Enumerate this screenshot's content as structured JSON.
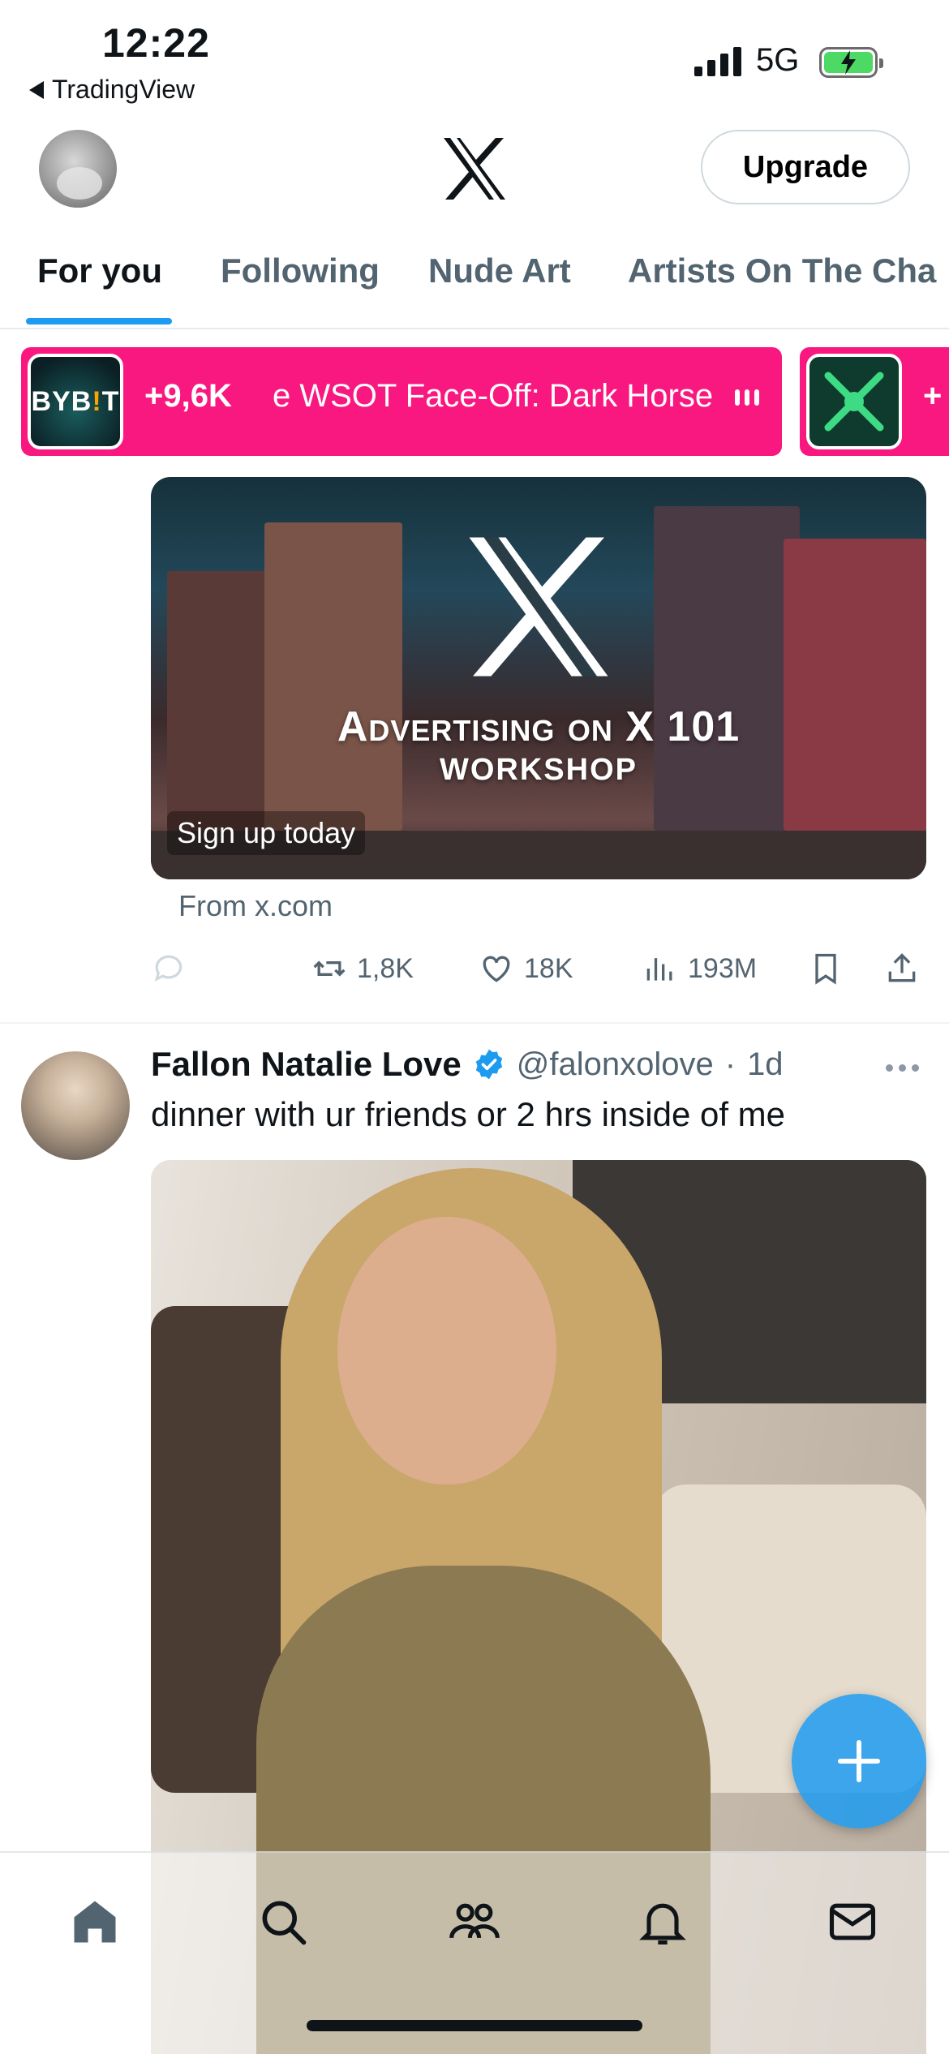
{
  "status_bar": {
    "time": "12:22",
    "back_app": "TradingView",
    "network": "5G",
    "battery_charging": true
  },
  "header": {
    "logo": "x-logo",
    "upgrade_label": "Upgrade"
  },
  "tabs": [
    {
      "label": "For you",
      "active": true
    },
    {
      "label": "Following",
      "active": false
    },
    {
      "label": "Nude Art",
      "active": false
    },
    {
      "label": "Artists On The Cha",
      "active": false
    }
  ],
  "live_banner": {
    "card1": {
      "logo_text_a": "BYB",
      "logo_text_b": "!",
      "logo_text_c": "T",
      "count": "+9,6K",
      "title": "e WSOT Face-Off: Dark Horse"
    },
    "card2": {
      "count": "+"
    },
    "color": "#f91880"
  },
  "ad": {
    "headline_a": "Advertising on ",
    "headline_b": "X 101",
    "subheadline": "WORKSHOP",
    "cta": "Sign up today",
    "source": "From x.com"
  },
  "ad_actions": {
    "reposts": "1,8K",
    "likes": "18K",
    "views": "193M"
  },
  "post": {
    "author": "Fallon Natalie Love",
    "handle": "@falonxolove",
    "separator": "·",
    "time": "1d",
    "text": "dinner with ur friends or 2 hrs inside of me"
  },
  "nav": {
    "items": [
      "home-icon",
      "search-icon",
      "communities-icon",
      "notifications-icon",
      "messages-icon"
    ]
  },
  "colors": {
    "accent": "#1d9bf0",
    "text": "#0f1419",
    "secondary": "#536471"
  }
}
